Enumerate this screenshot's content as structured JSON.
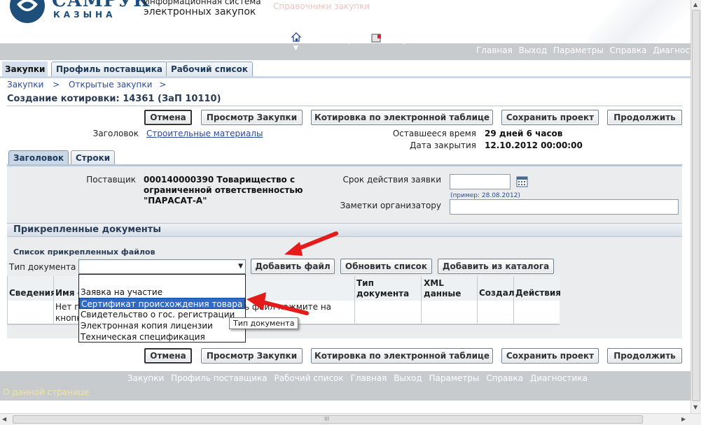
{
  "brand": {
    "logo_line1": "САМРУК",
    "logo_line2": "КАЗЫНА",
    "system_line1": "Информационная система",
    "system_line2": "электронных закупок",
    "faded_text": "Справочники закупки"
  },
  "topnav": {
    "navigator": "Навигатор",
    "favorites": "Избранное",
    "links": [
      "Главная",
      "Выход",
      "Параметры",
      "Справка",
      "Диагности"
    ]
  },
  "maintabs": [
    "Закупки",
    "Профиль поставщика",
    "Рабочий список"
  ],
  "breadcrumb": {
    "item1": "Закупки",
    "sep": ">",
    "item2": "Открытые закупки"
  },
  "page_title": "Создание котировки: 14361 (ЗаП 10110)",
  "buttons": {
    "cancel": "Отмена",
    "view": "Просмотр Закупки",
    "spreadsheet": "Котировка по электронной таблице",
    "save": "Сохранить проект",
    "continue": "Продолжить",
    "add_file": "Добавить файл",
    "refresh": "Обновить список",
    "add_catalog": "Добавить из каталога"
  },
  "header_info": {
    "heading_label": "Заголовок",
    "heading_value": "Строительные материалы",
    "remaining_label": "Оставшееся время",
    "remaining_value": "29 дней 6 часов",
    "close_label": "Дата закрытия",
    "close_value": "12.10.2012 00:00:00"
  },
  "subtabs": [
    "Заголовок",
    "Строки"
  ],
  "form": {
    "supplier_label": "Поставщик",
    "supplier_value": "000140000390 Товарищество с ограниченной ответственностью \"ПАРАСАТ-А\"",
    "validity_label": "Срок действия заявки",
    "validity_value": "",
    "validity_hint": "(пример: 28.08.2012)",
    "notes_label": "Заметки организатору",
    "notes_value": ""
  },
  "attachments": {
    "section_title": "Прикрепленные документы",
    "list_title": "Список прикрепленных файлов",
    "doc_type_label": "Тип документа",
    "doc_type_value": "",
    "columns": [
      "Сведения",
      "Имя ф",
      "Тип документа",
      "XML данные",
      "Создал",
      "Действия"
    ],
    "empty_msg_part1": "Нет п",
    "empty_msg_part2": "кнопк",
    "empty_msg_part3": "ь файл нажмите на"
  },
  "dropdown": {
    "options": [
      "",
      "Заявка на участие",
      "Сертификат происхождения товара",
      "Свидетельство о гос. регистрации",
      "Электронная копия лицензии",
      "Техническая спецификация"
    ],
    "highlighted_index": 2,
    "tooltip": "Тип документа"
  },
  "footer": {
    "links": [
      "Закупки",
      "Профиль поставщика",
      "Рабочий список",
      "Главная",
      "Выход",
      "Параметры",
      "Справка",
      "Диагностика"
    ],
    "about": "О данной странице"
  },
  "scrollbar": {
    "grip": "III"
  },
  "colors": {
    "accent": "#2b4a9c",
    "annotation_arrow": "#e31b1b",
    "highlight": "#316ac5"
  }
}
